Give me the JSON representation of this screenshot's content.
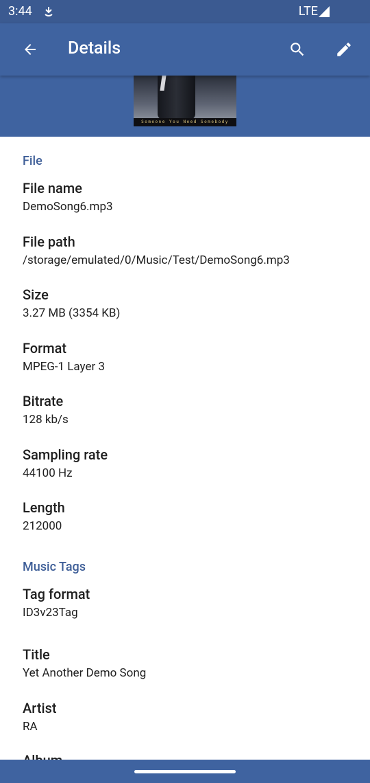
{
  "status_bar": {
    "time": "3:44",
    "network": "LTE",
    "app_icon": "notification-app-icon",
    "signal_icon": "signal-icon"
  },
  "app_bar": {
    "title": "Details",
    "back_icon": "arrow-back-icon",
    "search_icon": "search-icon",
    "edit_icon": "pencil-icon",
    "accent_color": "#3f63a0"
  },
  "album_art": {
    "caption": "Someone You Need Somebody"
  },
  "sections": {
    "file": {
      "header": "File",
      "fields": [
        {
          "label": "File name",
          "value": "DemoSong6.mp3"
        },
        {
          "label": "File path",
          "value": "/storage/emulated/0/Music/Test/DemoSong6.mp3"
        },
        {
          "label": "Size",
          "value": "3.27 MB (3354 KB)"
        },
        {
          "label": "Format",
          "value": "MPEG-1 Layer 3"
        },
        {
          "label": "Bitrate",
          "value": "128 kb/s"
        },
        {
          "label": "Sampling rate",
          "value": "44100 Hz"
        },
        {
          "label": "Length",
          "value": "212000"
        }
      ]
    },
    "music_tags": {
      "header": "Music Tags",
      "fields": [
        {
          "label": "Tag format",
          "value": "ID3v23Tag"
        },
        {
          "label": "Title",
          "value": "Yet Another Demo Song"
        },
        {
          "label": "Artist",
          "value": "RA"
        },
        {
          "label": "Album",
          "value": ""
        }
      ]
    }
  }
}
